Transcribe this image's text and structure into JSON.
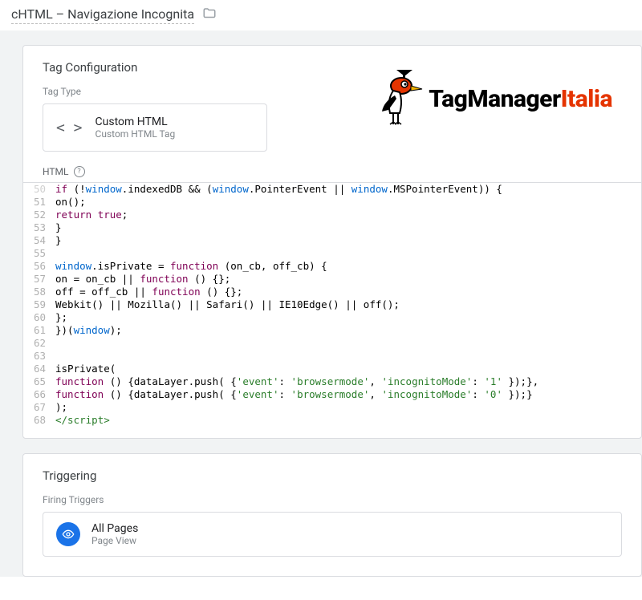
{
  "header": {
    "title": "cHTML – Navigazione Incognita"
  },
  "tagConfig": {
    "sectionTitle": "Tag Configuration",
    "tagTypeLabel": "Tag Type",
    "tagTypeName": "Custom HTML",
    "tagTypeSub": "Custom HTML Tag",
    "htmlLabel": "HTML"
  },
  "logo": {
    "part1": "TagManager",
    "part2": "Italia"
  },
  "code": {
    "lines": [
      {
        "n": 50,
        "cut": true,
        "segments": [
          {
            "t": "if",
            "c": "kw"
          },
          {
            "t": " (!",
            "c": "ident"
          },
          {
            "t": "window",
            "c": "win"
          },
          {
            "t": ".indexedDB && (",
            "c": "ident"
          },
          {
            "t": "window",
            "c": "win"
          },
          {
            "t": ".PointerEvent || ",
            "c": "ident"
          },
          {
            "t": "window",
            "c": "win"
          },
          {
            "t": ".MSPointerEvent)) {",
            "c": "ident"
          }
        ]
      },
      {
        "n": 51,
        "segments": [
          {
            "t": "on();",
            "c": "ident"
          }
        ]
      },
      {
        "n": 52,
        "segments": [
          {
            "t": "return",
            "c": "kw"
          },
          {
            "t": " ",
            "c": "ident"
          },
          {
            "t": "true",
            "c": "kw"
          },
          {
            "t": ";",
            "c": "ident"
          }
        ]
      },
      {
        "n": 53,
        "segments": [
          {
            "t": "}",
            "c": "ident"
          }
        ]
      },
      {
        "n": 54,
        "segments": [
          {
            "t": "}",
            "c": "ident"
          }
        ]
      },
      {
        "n": 55,
        "segments": []
      },
      {
        "n": 56,
        "segments": [
          {
            "t": "window",
            "c": "win"
          },
          {
            "t": ".isPrivate = ",
            "c": "ident"
          },
          {
            "t": "function",
            "c": "kw"
          },
          {
            "t": " (on_cb, off_cb) {",
            "c": "ident"
          }
        ]
      },
      {
        "n": 57,
        "segments": [
          {
            "t": "on = on_cb || ",
            "c": "ident"
          },
          {
            "t": "function",
            "c": "kw"
          },
          {
            "t": " () {};",
            "c": "ident"
          }
        ]
      },
      {
        "n": 58,
        "segments": [
          {
            "t": "off = off_cb || ",
            "c": "ident"
          },
          {
            "t": "function",
            "c": "kw"
          },
          {
            "t": " () {};",
            "c": "ident"
          }
        ]
      },
      {
        "n": 59,
        "segments": [
          {
            "t": "Webkit() || Mozilla() || Safari() || IE10Edge() || off();",
            "c": "ident"
          }
        ]
      },
      {
        "n": 60,
        "segments": [
          {
            "t": "};",
            "c": "ident"
          }
        ]
      },
      {
        "n": 61,
        "segments": [
          {
            "t": "})(",
            "c": "ident"
          },
          {
            "t": "window",
            "c": "win"
          },
          {
            "t": ");",
            "c": "ident"
          }
        ]
      },
      {
        "n": 62,
        "segments": []
      },
      {
        "n": 63,
        "segments": []
      },
      {
        "n": 64,
        "segments": [
          {
            "t": "isPrivate(",
            "c": "ident"
          }
        ]
      },
      {
        "n": 65,
        "segments": [
          {
            "t": "function",
            "c": "kw"
          },
          {
            "t": " () {dataLayer.push( {",
            "c": "ident"
          },
          {
            "t": "'event'",
            "c": "str"
          },
          {
            "t": ": ",
            "c": "ident"
          },
          {
            "t": "'browsermode'",
            "c": "str"
          },
          {
            "t": ", ",
            "c": "ident"
          },
          {
            "t": "'incognitoMode'",
            "c": "str"
          },
          {
            "t": ": ",
            "c": "ident"
          },
          {
            "t": "'1'",
            "c": "str"
          },
          {
            "t": " });},",
            "c": "ident"
          }
        ]
      },
      {
        "n": 66,
        "segments": [
          {
            "t": "function",
            "c": "kw"
          },
          {
            "t": " () {dataLayer.push( {",
            "c": "ident"
          },
          {
            "t": "'event'",
            "c": "str"
          },
          {
            "t": ": ",
            "c": "ident"
          },
          {
            "t": "'browsermode'",
            "c": "str"
          },
          {
            "t": ", ",
            "c": "ident"
          },
          {
            "t": "'incognitoMode'",
            "c": "str"
          },
          {
            "t": ": ",
            "c": "ident"
          },
          {
            "t": "'0'",
            "c": "str"
          },
          {
            "t": " });}",
            "c": "ident"
          }
        ]
      },
      {
        "n": 67,
        "segments": [
          {
            "t": ");",
            "c": "ident"
          }
        ]
      },
      {
        "n": 68,
        "segments": [
          {
            "t": "</scr",
            "c": "tag"
          },
          {
            "t": "ipt>",
            "c": "tag"
          }
        ]
      }
    ]
  },
  "triggering": {
    "sectionTitle": "Triggering",
    "firingLabel": "Firing Triggers",
    "triggerName": "All Pages",
    "triggerSub": "Page View"
  }
}
